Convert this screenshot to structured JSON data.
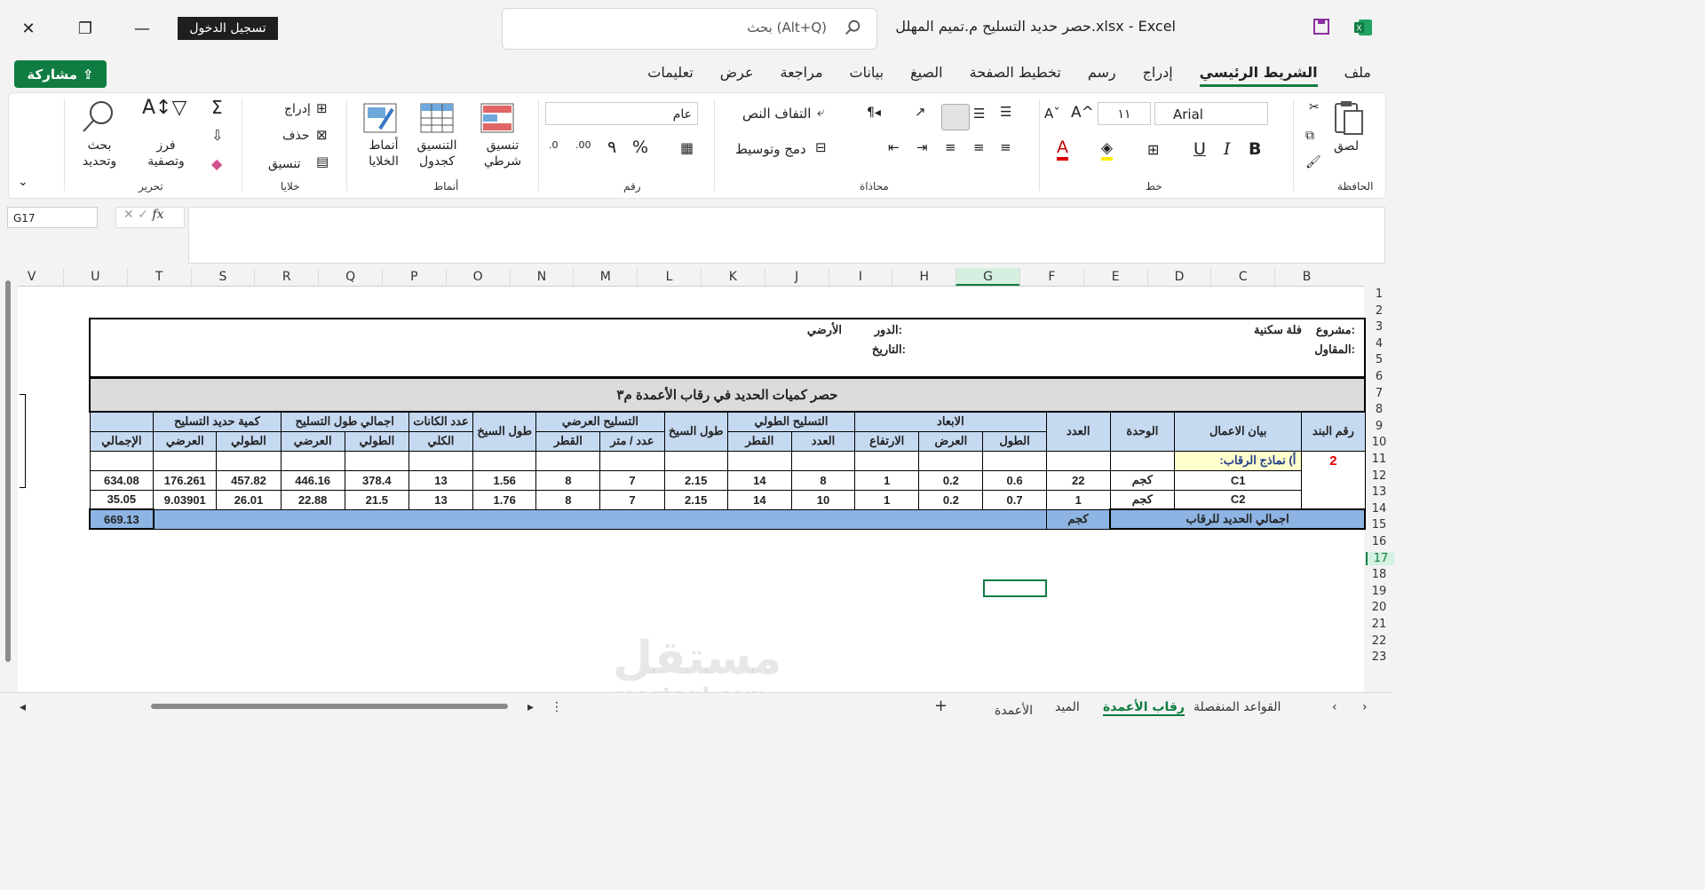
{
  "window": {
    "title": "حصر حديد التسليح م.تميم المهلل.xlsx  -  Excel",
    "signin": "تسجيل الدخول",
    "search_placeholder": "بحث (Alt+Q)"
  },
  "share_label": "مشاركة",
  "tabs": [
    "ملف",
    "الشريط الرئيسي",
    "إدراج",
    "رسم",
    "تخطيط الصفحة",
    "الصيغ",
    "بيانات",
    "مراجعة",
    "عرض",
    "تعليمات"
  ],
  "ribbon": {
    "clipboard": {
      "label": "الحافظة",
      "paste": "لصق"
    },
    "font": {
      "label": "خط",
      "name": "Arial",
      "size": "١١"
    },
    "alignment": {
      "label": "محاذاة",
      "wrap": "التفاف النص",
      "merge": "دمج وتوسيط"
    },
    "number": {
      "label": "رقم",
      "format": "عام"
    },
    "styles": {
      "label": "أنماط",
      "conditional": "تنسيق شرطي",
      "table": "التنسيق كجدول",
      "cell": "أنماط الخلايا"
    },
    "cells": {
      "label": "خلايا",
      "insert": "إدراج",
      "delete": "حذف",
      "format": "تنسيق"
    },
    "editing": {
      "label": "تحرير",
      "sort": "فرز وتصفية",
      "find": "بحث وتحديد"
    }
  },
  "namebox": "G17",
  "columns": [
    "B",
    "C",
    "D",
    "E",
    "F",
    "G",
    "H",
    "I",
    "J",
    "K",
    "L",
    "M",
    "N",
    "O",
    "P",
    "Q",
    "R",
    "S",
    "T",
    "U",
    "V"
  ],
  "rows": [
    "1",
    "2",
    "3",
    "4",
    "5",
    "6",
    "7",
    "8",
    "9",
    "10",
    "11",
    "12",
    "13",
    "14",
    "15",
    "16",
    "17",
    "18",
    "19",
    "20",
    "21",
    "22",
    "23"
  ],
  "sheet": {
    "project_label": "مشروع:",
    "project_value": "فلة سكنية",
    "contractor_label": "المقاول:",
    "floor_label": "الدور:",
    "floor_value": "الأرضي",
    "date_label": "التاريخ:",
    "table_title": "حصر كميات الحديد في رقاب الأعمدة م٣",
    "headers": {
      "item_no": "رقم البند",
      "description": "بيان الاعمال",
      "unit": "الوحدة",
      "count": "العدد",
      "dims": "الابعاد",
      "length": "الطول",
      "width": "العرض",
      "height": "الارتفاع",
      "long_rebar": "التسليح الطولي",
      "num": "العدد",
      "diameter": "القطر",
      "bar_length": "طول السيخ",
      "trans_rebar": "التسليح العرضي",
      "per_meter": "عدد / متر",
      "stirrups": "عدد الكانات",
      "total": "الكلي",
      "total_length": "اجمالي طول التسليح",
      "longitudinal": "الطولي",
      "transverse": "العرضي",
      "qty": "كمية حديد التسليح",
      "grand": "الإجمالي"
    },
    "item_number": "2",
    "section_label": "أ) نماذج الرقاب:",
    "data_rows": [
      [
        "C1",
        "كجم",
        "22",
        "0.6",
        "0.2",
        "1",
        "8",
        "14",
        "2.15",
        "7",
        "8",
        "1.56",
        "13",
        "378.4",
        "446.16",
        "457.82",
        "176.261",
        "634.08"
      ],
      [
        "C2",
        "كجم",
        "1",
        "0.7",
        "0.2",
        "1",
        "10",
        "14",
        "2.15",
        "7",
        "8",
        "1.76",
        "13",
        "21.5",
        "22.88",
        "26.01",
        "9.03901",
        "35.05"
      ]
    ],
    "total_label": "اجمالي الحديد للرقاب",
    "total_unit": "كجم",
    "total_value": "669.13"
  },
  "sheet_tabs": [
    "القواعد المنفصلة",
    "رقاب الأعمدة",
    "الميد",
    "الأعمدة"
  ],
  "active_sheet": "رقاب الأعمدة",
  "watermark": {
    "main": "مستقل",
    "sub": "mostaql.com"
  }
}
